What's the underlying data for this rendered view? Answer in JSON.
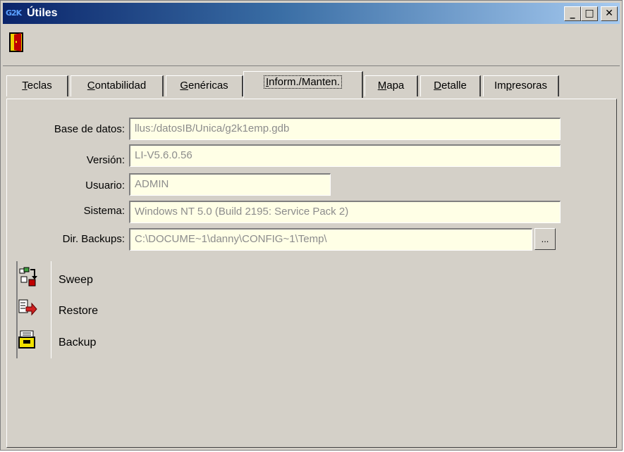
{
  "window": {
    "app_badge": "G2K",
    "title": "Útiles",
    "controls": {
      "minimize": "_",
      "maximize": "□",
      "close": "✕"
    }
  },
  "toolbar": {
    "exit_icon": "exit-door-icon"
  },
  "tabs": [
    {
      "prefix": "",
      "ul": "T",
      "rest": "eclas",
      "active": false
    },
    {
      "prefix": "",
      "ul": "C",
      "rest": "ontabilidad",
      "active": false
    },
    {
      "prefix": "",
      "ul": "G",
      "rest": "enéricas",
      "active": false
    },
    {
      "prefix": "",
      "ul": "I",
      "rest": "nform./Manten.",
      "active": true
    },
    {
      "prefix": "",
      "ul": "M",
      "rest": "apa",
      "active": false
    },
    {
      "prefix": "",
      "ul": "D",
      "rest": "etalle",
      "active": false
    },
    {
      "prefix": "Im",
      "ul": "p",
      "rest": "resoras",
      "active": false
    }
  ],
  "info": {
    "db_label": "Base de datos:",
    "db_value": "llus:/datosIB/Unica/g2k1emp.gdb",
    "version_label": "Versión:",
    "version_value": "LI-V5.6.0.56",
    "user_label": "Usuario:",
    "user_value": "ADMIN",
    "system_label": "Sistema:",
    "system_value": "Windows NT 5.0 (Build 2195: Service Pack 2)",
    "backup_dir_label": "Dir. Backups:",
    "backup_dir_value": "C:\\DOCUME~1\\danny\\CONFIG~1\\Temp\\",
    "browse_label": "..."
  },
  "actions": [
    {
      "label": "Sweep",
      "icon": "sweep-icon"
    },
    {
      "label": "Restore",
      "icon": "restore-icon"
    },
    {
      "label": "Backup",
      "icon": "backup-icon"
    }
  ],
  "colors": {
    "face": "#d4d0c8",
    "title_start": "#0a246a",
    "title_end": "#a6caf0",
    "field_bg": "#ffffe6",
    "field_text": "#8c8c8c"
  }
}
